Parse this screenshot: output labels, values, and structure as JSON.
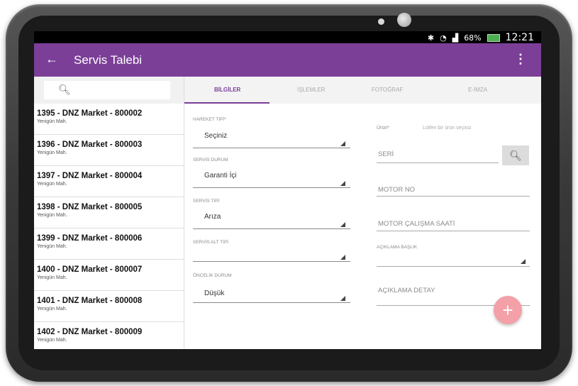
{
  "status_bar": {
    "bluetooth_icon": "bluetooth-icon",
    "wifi_icon": "wifi-icon",
    "signal_icon": "signal-icon",
    "battery": "68%",
    "time": "12:21"
  },
  "app_bar": {
    "title": "Servis Talebi",
    "back_icon": "arrow-left-icon",
    "menu_icon": "more-vert-icon"
  },
  "colors": {
    "primary": "#7b3f98",
    "fab": "#f4a0a8"
  },
  "left_panel": {
    "search_icon": "search-icon",
    "items": [
      {
        "title": "1395 - DNZ Market - 800002",
        "subtitle": "Yenigün Mah."
      },
      {
        "title": "1396 - DNZ Market - 800003",
        "subtitle": "Yenigün Mah."
      },
      {
        "title": "1397 - DNZ Market - 800004",
        "subtitle": "Yenigün Mah."
      },
      {
        "title": "1398 - DNZ Market - 800005",
        "subtitle": "Yenigün Mah."
      },
      {
        "title": "1399 - DNZ Market - 800006",
        "subtitle": "Yenigün Mah."
      },
      {
        "title": "1400 - DNZ Market - 800007",
        "subtitle": "Yenigün Mah."
      },
      {
        "title": "1401 - DNZ Market - 800008",
        "subtitle": "Yenigün Mah."
      },
      {
        "title": "1402 - DNZ Market - 800009",
        "subtitle": "Yenigün Mah."
      }
    ]
  },
  "tabs": [
    {
      "label": "BİLGİLER",
      "active": true
    },
    {
      "label": "İŞLEMLER",
      "active": false
    },
    {
      "label": "FOTOĞRAF",
      "active": false
    },
    {
      "label": "E-İMZA",
      "active": false
    }
  ],
  "form_left": {
    "hareket_tipi": {
      "label": "HAREKET TİPİ*",
      "value": "Seçiniz"
    },
    "servis_durum": {
      "label": "SERVİS DURUM",
      "value": "Garanti İçi"
    },
    "servis_tipi": {
      "label": "SERVİS TİPİ",
      "value": "Arıza"
    },
    "servis_alt_tipi": {
      "label": "SERVİS ALT TİPİ",
      "value": ""
    },
    "oncelik_durum": {
      "label": "ÖNCELİK DURUM",
      "value": "Düşük"
    }
  },
  "form_right": {
    "urun_label": "Ürün*",
    "urun_placeholder": "Lütfen bir ürün seçiniz",
    "seri": "SERİ",
    "motor_no": "MOTOR NO",
    "motor_calisma": "MOTOR ÇALIŞMA SAATİ",
    "aciklama_baslik": "AÇIKLAMA BAŞLIK",
    "aciklama_detay": "AÇIKLAMA DETAY",
    "fab_label": "+"
  }
}
